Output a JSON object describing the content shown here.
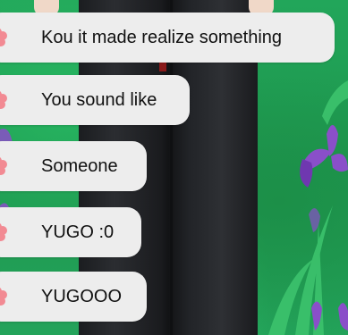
{
  "messages": [
    {
      "text": "Kou it made realize something"
    },
    {
      "text": "You sound like"
    },
    {
      "text": "Someone"
    },
    {
      "text": "YUGO :0"
    },
    {
      "text": "YUGOOO"
    }
  ],
  "icon": "hibiscus-flower-icon",
  "colors": {
    "background": "#1f9a52",
    "bubble": "#ededed",
    "text": "#111111",
    "flower": "#f28a93",
    "iris": "#8a4fc9"
  }
}
